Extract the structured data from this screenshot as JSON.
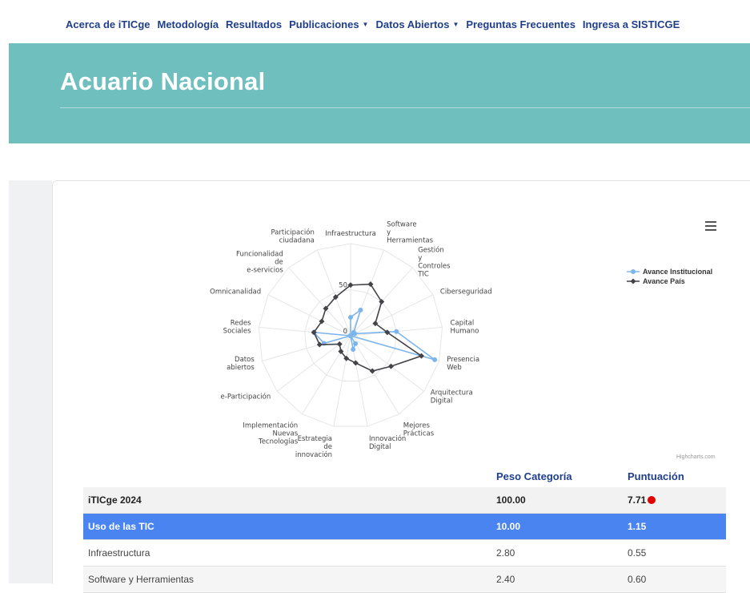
{
  "nav": {
    "items": [
      {
        "label": "Acerca de iTICge",
        "dropdown": false
      },
      {
        "label": "Metodología",
        "dropdown": false
      },
      {
        "label": "Resultados",
        "dropdown": false
      },
      {
        "label": "Publicaciones",
        "dropdown": true
      },
      {
        "label": "Datos Abiertos",
        "dropdown": true
      },
      {
        "label": "Preguntas Frecuentes",
        "dropdown": false
      },
      {
        "label": "Ingresa a SISTICGE",
        "dropdown": false
      }
    ]
  },
  "hero": {
    "title": "Acuario Nacional",
    "bg_color": "#6fbfbf"
  },
  "chart_data": {
    "type": "radar",
    "categories": [
      "Infraestructura",
      "Software y Herramientas",
      "Gestión y Controles TIC",
      "Ciberseguridad",
      "Capital Humano",
      "Presencia Web",
      "Arquitectura Digital",
      "Mejores Prácticas",
      "Innovación Digital",
      "Estrategia de innovación",
      "Implementación Nuevas Tecnologías",
      "e-Participación",
      "Datos abiertos",
      "Redes Sociales",
      "Omnicanalidad",
      "Funcionalidad de e-servicios",
      "Participación ciudadana"
    ],
    "ylim": [
      0,
      100
    ],
    "tick_labels": [
      "0",
      "50"
    ],
    "series": [
      {
        "name": "Avance Institucional",
        "color": "#7cb5ec",
        "values": [
          20,
          30,
          5,
          5,
          50,
          95,
          0,
          10,
          15,
          0,
          0,
          0,
          30,
          40,
          0,
          0,
          0
        ]
      },
      {
        "name": "Avance País",
        "color": "#434348",
        "values": [
          55,
          60,
          50,
          30,
          40,
          80,
          55,
          45,
          30,
          25,
          20,
          15,
          35,
          40,
          35,
          40,
          45
        ]
      }
    ],
    "legend_position": "right",
    "credits": "Highcharts.com"
  },
  "table": {
    "headers": [
      "",
      "Peso Categoría",
      "Puntuación"
    ],
    "rows": [
      {
        "name": "iTICge 2024",
        "peso": "100.00",
        "puntuacion": "7.71",
        "style": "total",
        "indicator": "red"
      },
      {
        "name": "Uso de las TIC",
        "peso": "10.00",
        "puntuacion": "1.15",
        "style": "section"
      },
      {
        "name": "Infraestructura",
        "peso": "2.80",
        "puntuacion": "0.55",
        "style": "plain"
      },
      {
        "name": "Software y Herramientas",
        "peso": "2.40",
        "puntuacion": "0.60",
        "style": "alt"
      }
    ]
  }
}
